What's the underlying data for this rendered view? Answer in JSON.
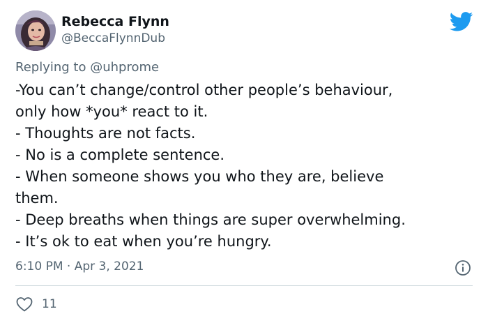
{
  "author": {
    "display_name": "Rebecca Flynn",
    "handle": "@BeccaFlynnDub",
    "avatar_icon": "profile-photo"
  },
  "brand": {
    "icon": "twitter-bird-icon",
    "color": "#1d9bf0"
  },
  "reply": {
    "prefix": "Replying to",
    "mention": "@uhprome"
  },
  "tweet": {
    "lines": [
      "-You can’t change/control other people’s behaviour,",
      "only how *you* react to it.",
      "- Thoughts are not facts.",
      "- No is a complete sentence.",
      "- When someone shows you who they are, believe",
      "them.",
      "- Deep breaths when things are super overwhelming.",
      "- It’s ok to eat when you’re hungry."
    ]
  },
  "meta": {
    "timestamp": "6:10 PM · Apr 3, 2021",
    "info_icon": "info-icon"
  },
  "engagement": {
    "like_icon": "heart-icon",
    "like_count": "11"
  },
  "colors": {
    "text": "#0f1419",
    "secondary": "#536471",
    "divider": "#cfd9de",
    "accent": "#1d9bf0"
  }
}
